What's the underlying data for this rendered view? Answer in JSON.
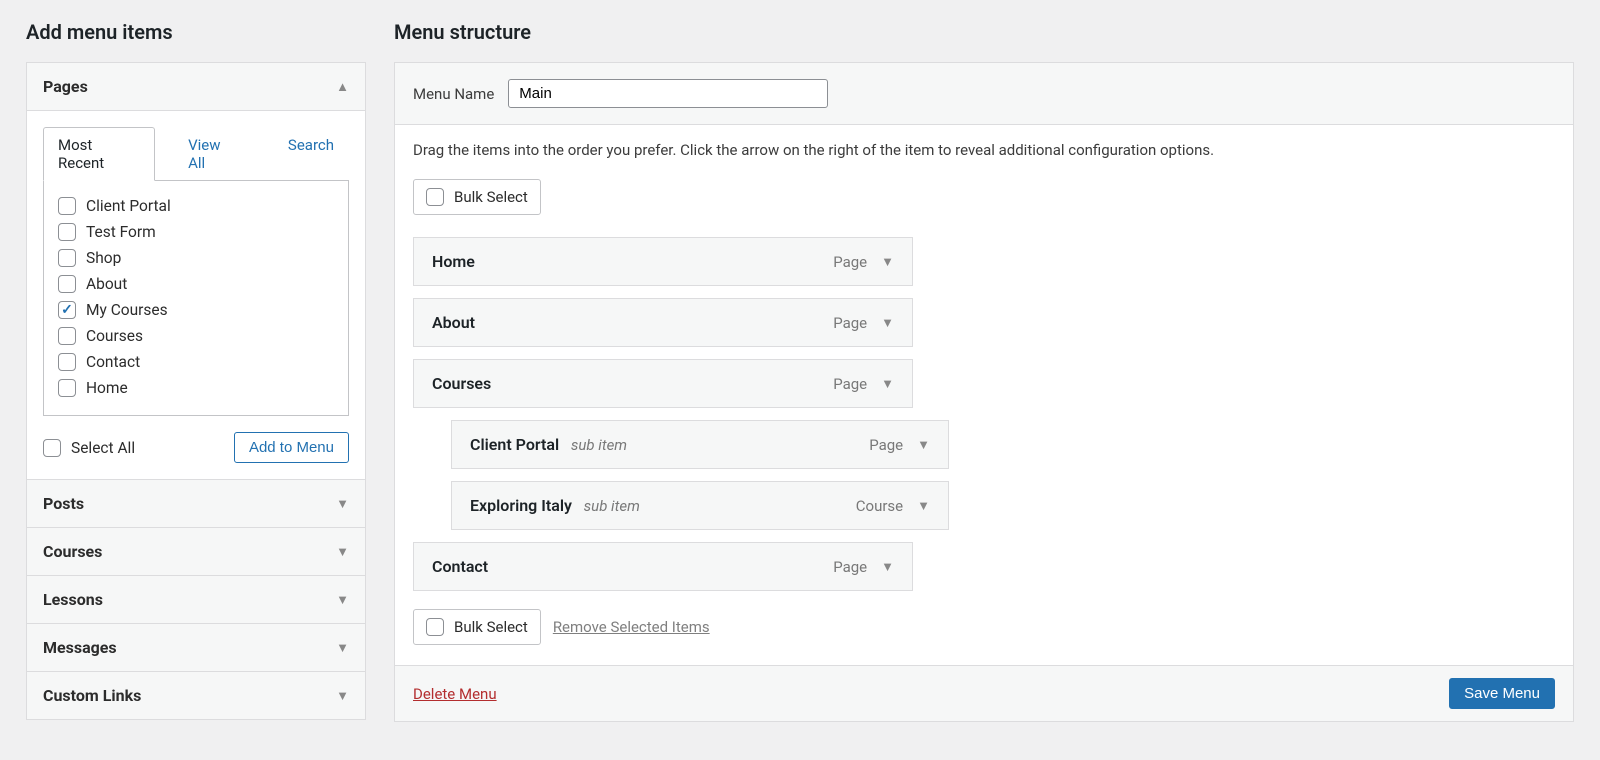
{
  "left": {
    "heading": "Add menu items",
    "sections": [
      {
        "label": "Pages",
        "open": true
      },
      {
        "label": "Posts",
        "open": false
      },
      {
        "label": "Courses",
        "open": false
      },
      {
        "label": "Lessons",
        "open": false
      },
      {
        "label": "Messages",
        "open": false
      },
      {
        "label": "Custom Links",
        "open": false
      }
    ],
    "tabs": {
      "most_recent": "Most Recent",
      "view_all": "View All",
      "search": "Search"
    },
    "pages": [
      {
        "label": "Client Portal",
        "checked": false
      },
      {
        "label": "Test Form",
        "checked": false
      },
      {
        "label": "Shop",
        "checked": false
      },
      {
        "label": "About",
        "checked": false
      },
      {
        "label": "My Courses",
        "checked": true
      },
      {
        "label": "Courses",
        "checked": false
      },
      {
        "label": "Contact",
        "checked": false
      },
      {
        "label": "Home",
        "checked": false
      }
    ],
    "select_all": "Select All",
    "add_to_menu": "Add to Menu"
  },
  "right": {
    "heading": "Menu structure",
    "menu_name_label": "Menu Name",
    "menu_name_value": "Main",
    "hint": "Drag the items into the order you prefer. Click the arrow on the right of the item to reveal additional configuration options.",
    "bulk_select": "Bulk Select",
    "remove_selected": "Remove Selected Items",
    "sub_item_label": "sub item",
    "items": [
      {
        "title": "Home",
        "type": "Page",
        "indent": false,
        "sub": false
      },
      {
        "title": "About",
        "type": "Page",
        "indent": false,
        "sub": false
      },
      {
        "title": "Courses",
        "type": "Page",
        "indent": false,
        "sub": false
      },
      {
        "title": "Client Portal",
        "type": "Page",
        "indent": true,
        "sub": true
      },
      {
        "title": "Exploring Italy",
        "type": "Course",
        "indent": true,
        "sub": true
      },
      {
        "title": "Contact",
        "type": "Page",
        "indent": false,
        "sub": false
      }
    ],
    "delete_menu": "Delete Menu",
    "save_menu": "Save Menu"
  }
}
